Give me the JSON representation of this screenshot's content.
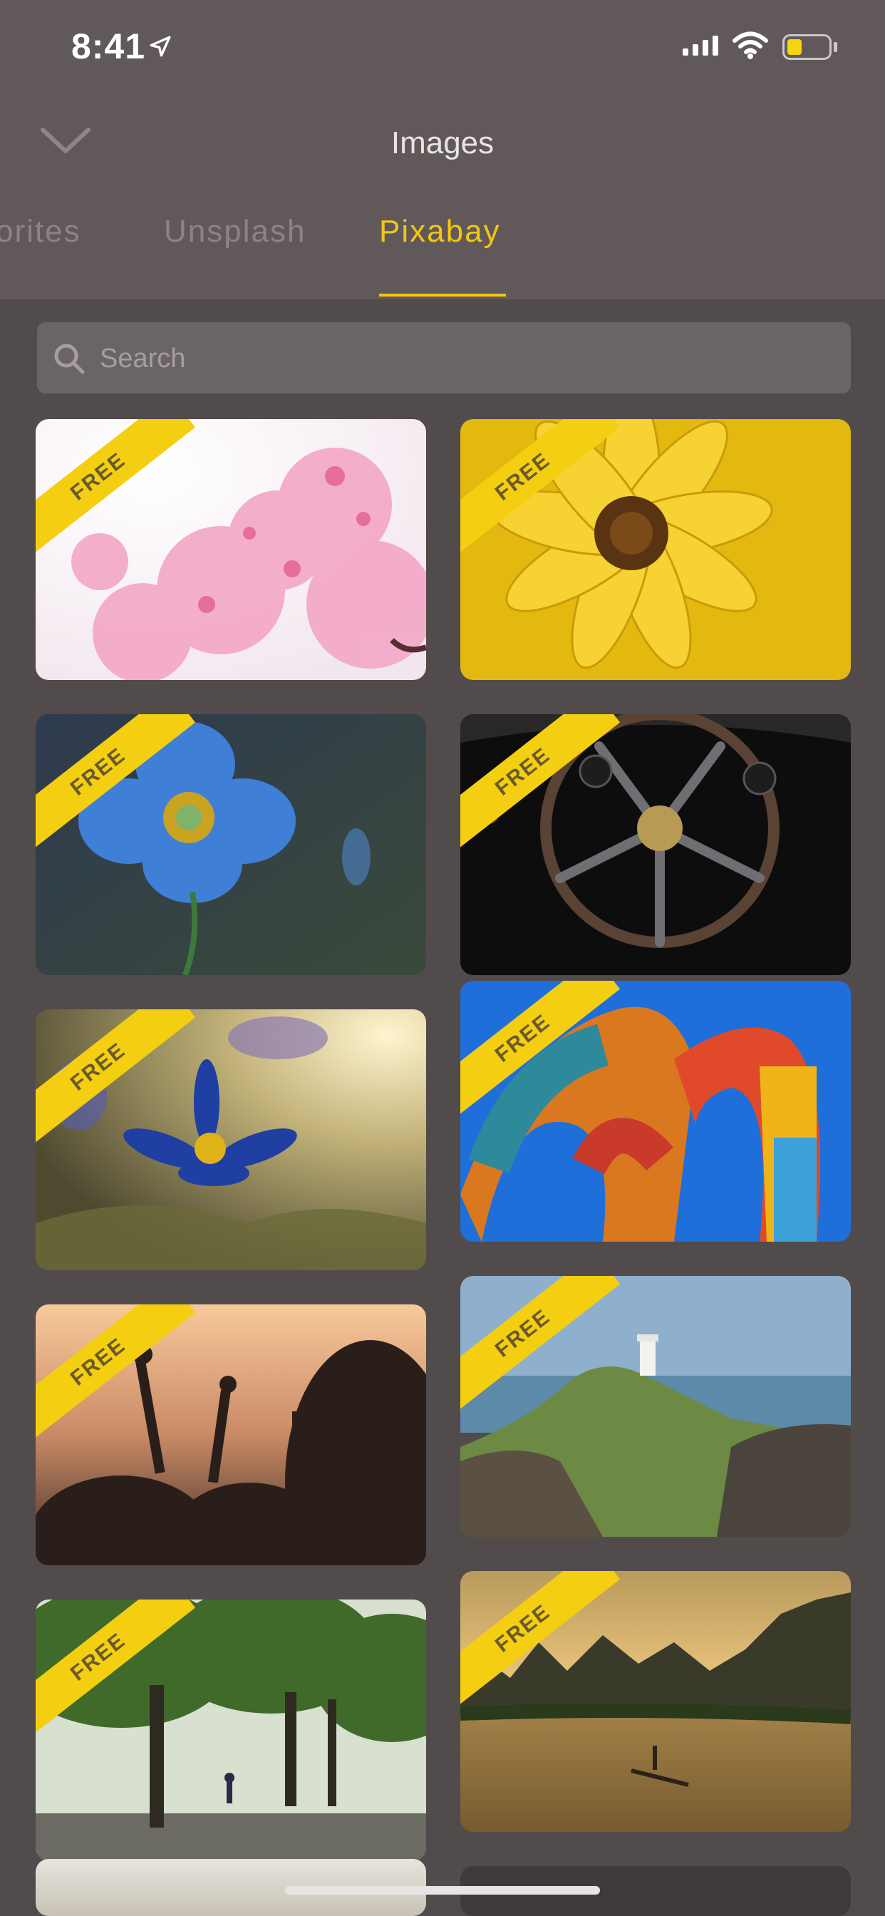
{
  "status": {
    "time": "8:41"
  },
  "header": {
    "title": "Images"
  },
  "tabs": [
    {
      "label": "Favorites",
      "visible_text": "vorites"
    },
    {
      "label": "Unsplash"
    },
    {
      "label": "Pixabay",
      "active": true
    }
  ],
  "search": {
    "placeholder": "Search",
    "value": ""
  },
  "badge_label": "FREE",
  "images": [
    {
      "subject": "pink cherry blossoms",
      "badge": "FREE"
    },
    {
      "subject": "yellow daisy with water drops",
      "badge": "FREE"
    },
    {
      "subject": "blue poppy flower",
      "badge": "FREE"
    },
    {
      "subject": "vintage car steering wheel",
      "badge": "FREE"
    },
    {
      "subject": "pasque flower in sunlight",
      "badge": "FREE"
    },
    {
      "subject": "shipping container arch",
      "badge": "FREE"
    },
    {
      "subject": "concert crowd hands up",
      "badge": "FREE"
    },
    {
      "subject": "lighthouse on rocky coast",
      "badge": "FREE"
    },
    {
      "subject": "trees in park",
      "badge": "FREE"
    },
    {
      "subject": "karst river at sunset",
      "badge": "FREE"
    },
    {
      "subject": "partially visible image"
    },
    {
      "subject": "partially visible image"
    }
  ],
  "colors": {
    "accent": "#f2c710",
    "badge": "#f4cf11",
    "background": "#524b4b",
    "header": "#615959"
  }
}
